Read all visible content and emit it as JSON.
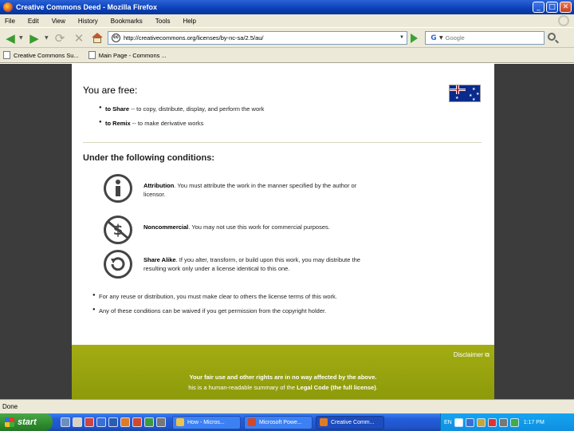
{
  "window": {
    "title": "Creative Commons Deed - Mozilla Firefox",
    "buttons": {
      "minimize": "_",
      "maximize": "□",
      "close": "✕"
    }
  },
  "menu": [
    "File",
    "Edit",
    "View",
    "History",
    "Bookmarks",
    "Tools",
    "Help"
  ],
  "nav": {
    "back": "◀",
    "forward": "▶",
    "reload": "⟳",
    "stop": "✕",
    "url": "http://creativecommons.org/licenses/by-nc-sa/2.5/au/",
    "search_engine": "G",
    "search_placeholder": "Google"
  },
  "bookmarks": [
    {
      "label": "Creative Commons Su..."
    },
    {
      "label": "Main Page - Commons ..."
    }
  ],
  "deed": {
    "free_heading": "You are free:",
    "free_items": [
      {
        "term": "to Share",
        "text": " -- to copy, distribute, display, and perform the work"
      },
      {
        "term": "to Remix",
        "text": " -- to make derivative works"
      }
    ],
    "conditions_heading": "Under the following conditions:",
    "conditions": [
      {
        "icon": "attribution-icon",
        "term": "Attribution",
        "text": ". You must attribute the work in the manner specified by the author or licensor."
      },
      {
        "icon": "noncommercial-icon",
        "term": "Noncommercial",
        "text": ". You may not use this work for commercial purposes."
      },
      {
        "icon": "share-alike-icon",
        "term": "Share Alike",
        "text": ". If you alter, transform, or build upon this work, you may distribute the resulting work only under a license identical to this one."
      }
    ],
    "notes": [
      "For any reuse or distribution, you must make clear to others the license terms of this work.",
      "Any of these conditions can be waived if you get permission from the copyright holder."
    ],
    "disclaimer": "Disclaimer",
    "fair_use": "Your fair use and other rights are in no way affected by the above.",
    "summary_prefix": "his is a human-readable summary of the ",
    "summary_link": "Legal Code (the full license)",
    "summary_suffix": "."
  },
  "status": "Done",
  "taskbar": {
    "start": "start",
    "tasks": [
      {
        "label": "How - Micros..."
      },
      {
        "label": "Microsoft Powe..."
      },
      {
        "label": "Creative Comm..."
      }
    ],
    "lang": "EN",
    "clock": "1:17 PM"
  }
}
